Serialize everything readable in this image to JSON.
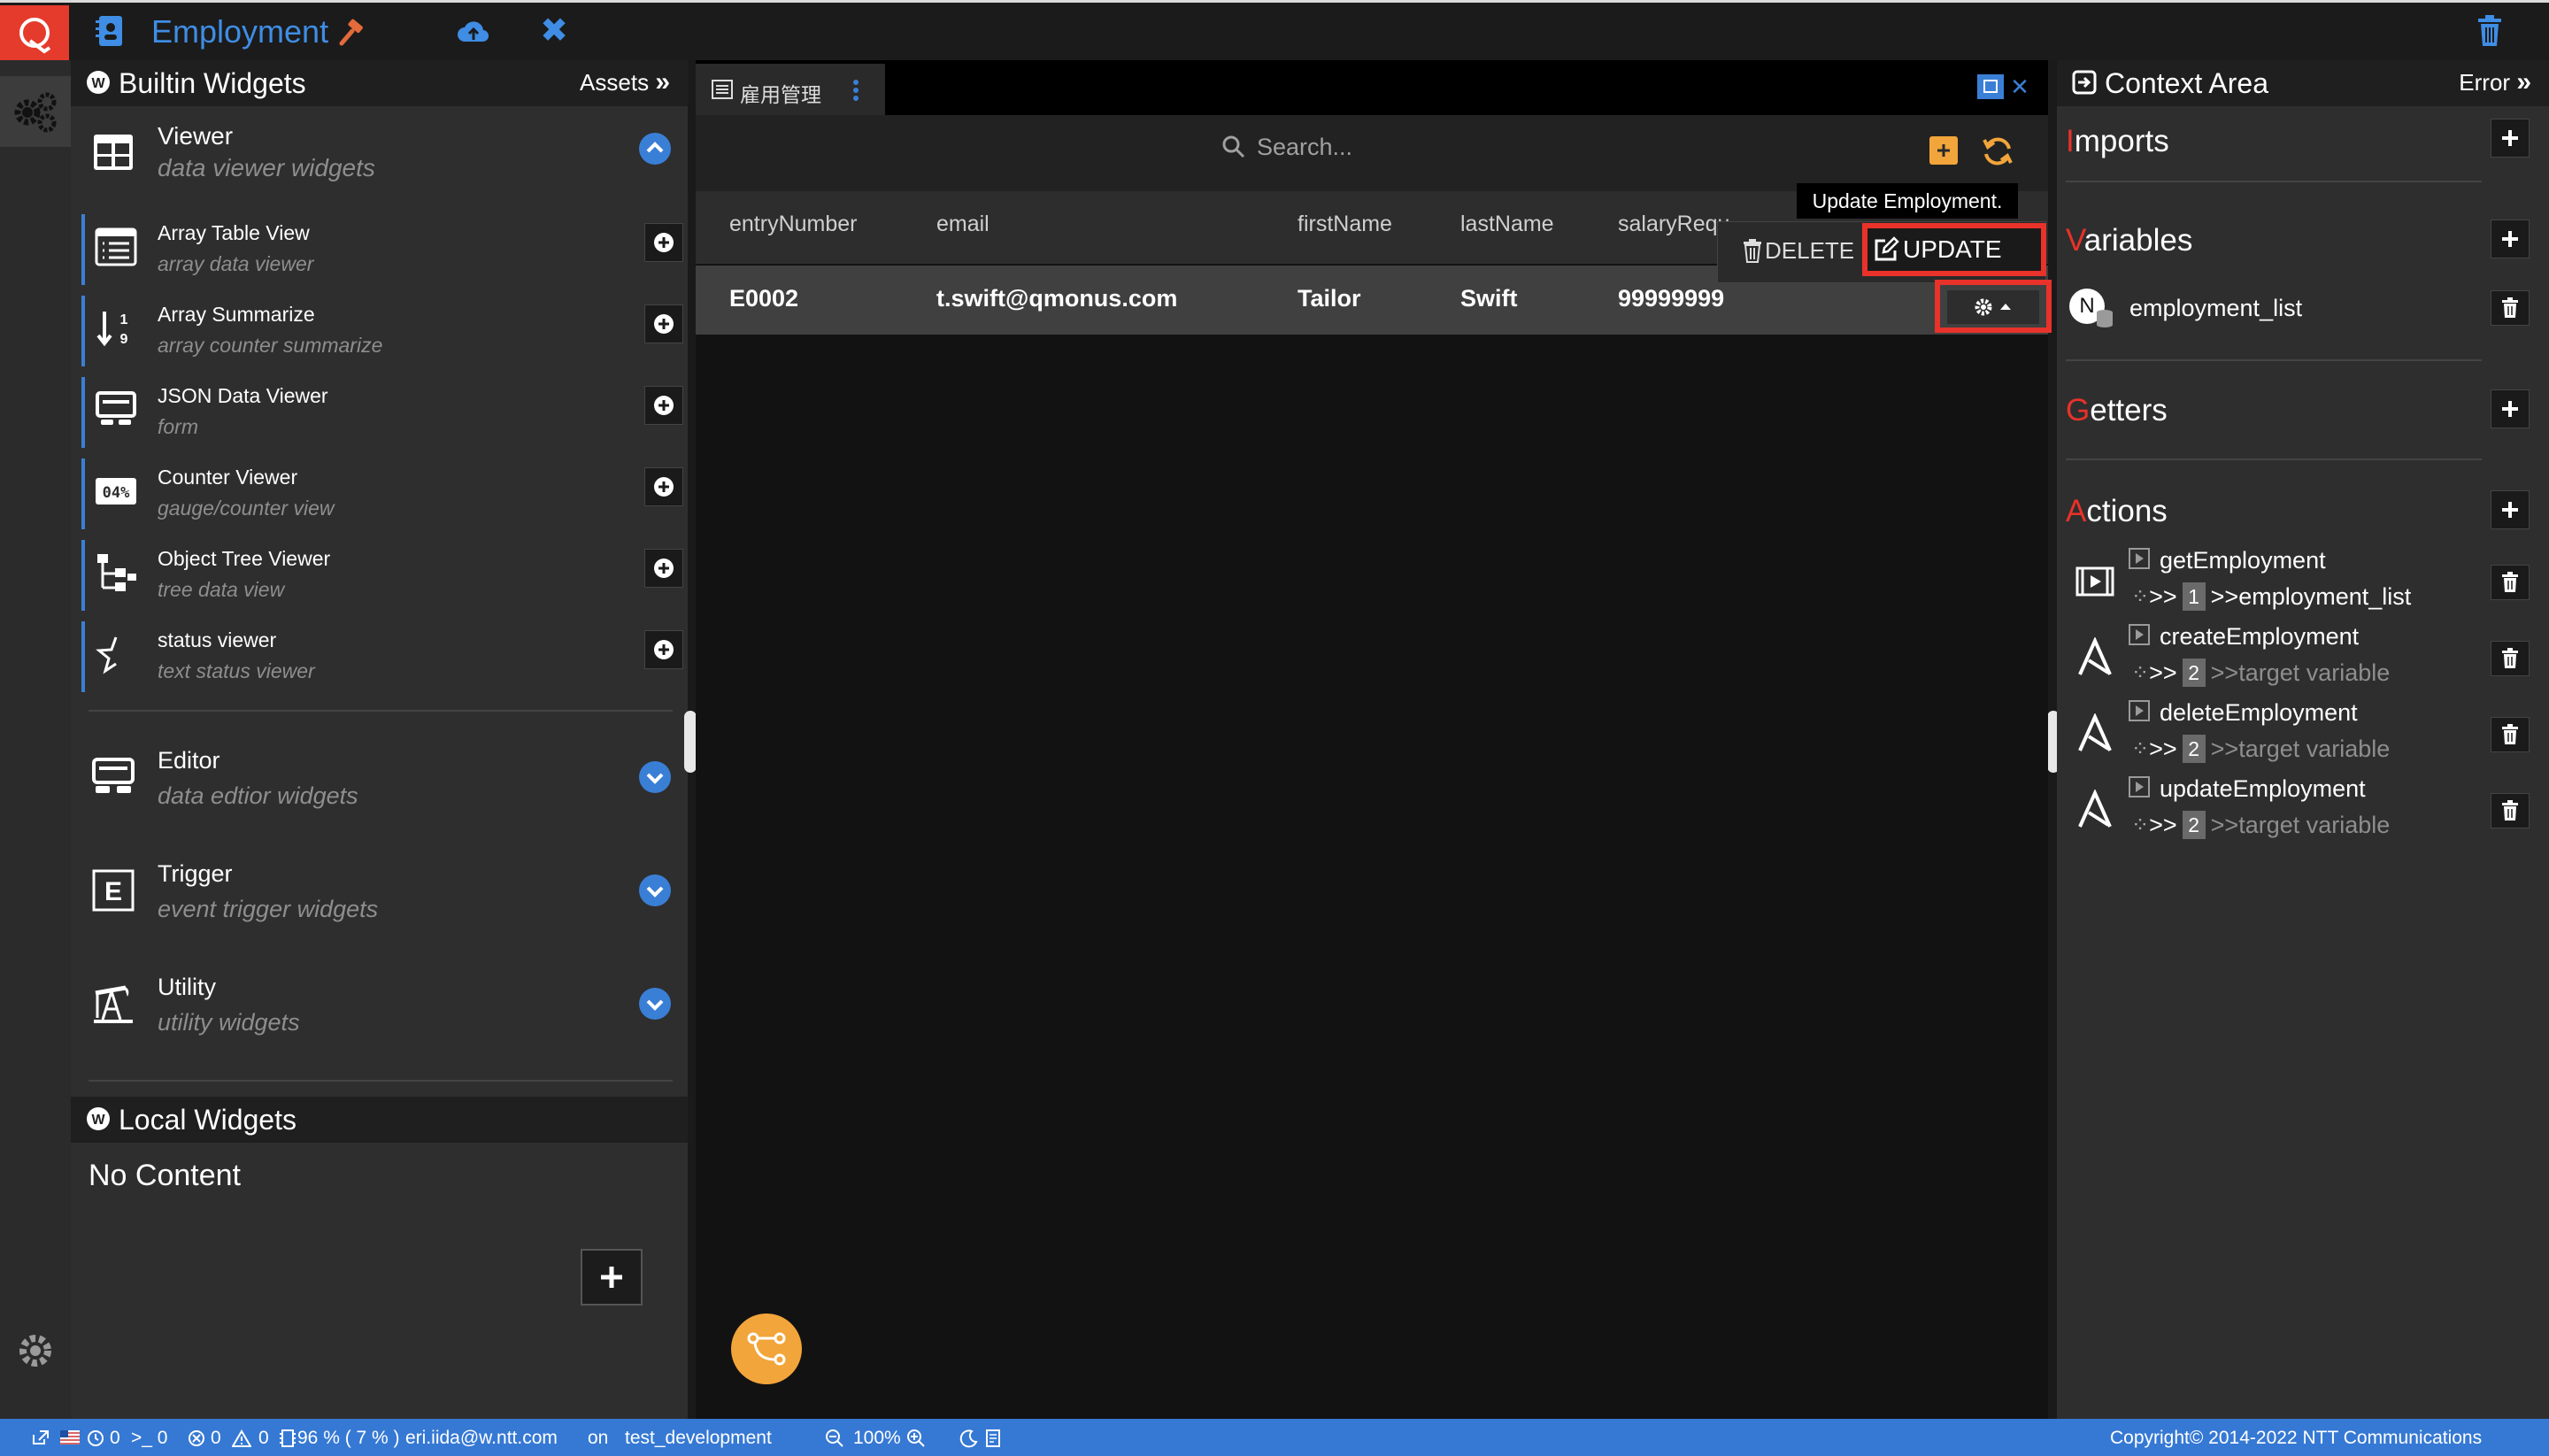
{
  "topbar": {
    "app_title": "Employment",
    "logo_letter": "Q"
  },
  "left_panel": {
    "header_title": "Builtin Widgets",
    "assets_label": "Assets",
    "groups": [
      {
        "title": "Viewer",
        "subtitle": "data viewer widgets"
      },
      {
        "title": "Editor",
        "subtitle": "data edtior widgets"
      },
      {
        "title": "Trigger",
        "subtitle": "event trigger widgets"
      },
      {
        "title": "Utility",
        "subtitle": "utility widgets"
      }
    ],
    "viewer_items": [
      {
        "title": "Array Table View",
        "subtitle": "array data viewer"
      },
      {
        "title": "Array Summarize",
        "subtitle": "array counter summarize"
      },
      {
        "title": "JSON Data Viewer",
        "subtitle": "form"
      },
      {
        "title": "Counter Viewer",
        "subtitle": "gauge/counter view"
      },
      {
        "title": "Object Tree Viewer",
        "subtitle": "tree data view"
      },
      {
        "title": "status viewer",
        "subtitle": "text status viewer"
      }
    ],
    "local_title": "Local Widgets",
    "no_content": "No Content"
  },
  "center": {
    "tab_label": "雇用管理",
    "search_placeholder": "Search...",
    "columns": [
      "entryNumber",
      "email",
      "firstName",
      "lastName",
      "salaryRequ"
    ],
    "row": {
      "entryNumber": "E0002",
      "email": "t.swift@qmonus.com",
      "firstName": "Tailor",
      "lastName": "Swift",
      "salary": "99999999"
    },
    "delete_label": "DELETE",
    "update_label": "UPDATE",
    "tooltip": "Update Employment."
  },
  "right_panel": {
    "header_title": "Context Area",
    "error_label": "Error",
    "imports": {
      "first": "I",
      "rest": "mports"
    },
    "variables": {
      "first": "V",
      "rest": "ariables",
      "items": [
        {
          "badge": "N",
          "name": "employment_list"
        }
      ]
    },
    "getters": {
      "first": "G",
      "rest": "etters"
    },
    "actions": {
      "first": "A",
      "rest": "ctions",
      "items": [
        {
          "name": "getEmployment",
          "count": "1",
          "target": ">>employment_list",
          "target_is_var": true
        },
        {
          "name": "createEmployment",
          "count": "2",
          "target": ">>target variable",
          "target_is_var": false
        },
        {
          "name": "deleteEmployment",
          "count": "2",
          "target": ">>target variable",
          "target_is_var": false
        },
        {
          "name": "updateEmployment",
          "count": "2",
          "target": ">>target variable",
          "target_is_var": false
        }
      ],
      "arrow": ">>"
    }
  },
  "statusbar": {
    "c1": "0",
    "c2": ">_ 0",
    "c3": "0",
    "c4": "0",
    "mem": "96 % ( 7 % )",
    "user": "eri.iida@w.ntt.com",
    "on": "on",
    "env": "test_development",
    "zoom": "100%",
    "copyright": "Copyright© 2014-2022 NTT Communications"
  },
  "colors": {
    "accent_blue": "#3a7fd6",
    "accent_red": "#e8322a",
    "accent_orange": "#f2a53a",
    "status_bar": "#3679d4"
  }
}
